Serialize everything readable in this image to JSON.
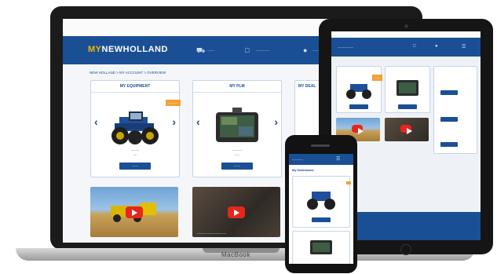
{
  "laptop": {
    "brand": "MacBook",
    "top_strip_text": "----------",
    "logo_prefix": "MY",
    "logo_main": "NEWHOLLAND",
    "header_item_1": "-------",
    "header_item_2": "-------------",
    "header_item_3": "-------------",
    "breadcrumb": "NEW HOLLAND  >  MY ACCOUNT  >  OVERVIEW",
    "card_equipment": {
      "title": "MY EQUIPMENT",
      "badge": "-----------",
      "caption_1": "---------",
      "caption_2": "----",
      "button": "-------"
    },
    "card_plm": {
      "title": "MY PLM",
      "caption_1": "-----------",
      "caption_2": "-----",
      "button": "-------"
    },
    "card_partial_title": "MY DEAL",
    "video_2_text": "--------------------------------"
  },
  "tablet": {
    "header_title": "---------------",
    "badge": "------"
  },
  "phone": {
    "header_title": "------------",
    "section_title": "My Dashboard"
  },
  "colors": {
    "brand_blue": "#1a4f95",
    "accent_yellow": "#f2b800",
    "badge_orange": "#f2a233",
    "play_red": "#e5261c"
  }
}
